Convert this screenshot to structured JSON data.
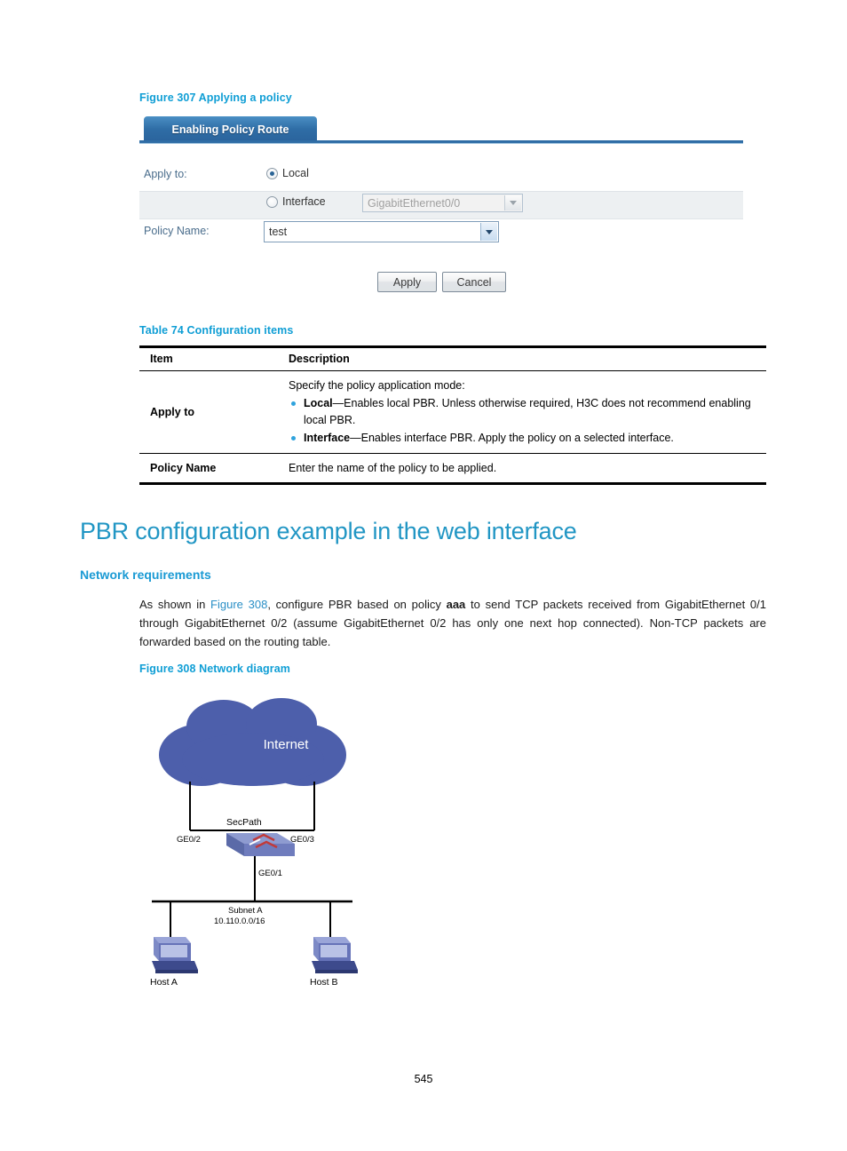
{
  "figure307": {
    "caption": "Figure 307 Applying a policy",
    "tab_label": "Enabling Policy Route",
    "apply_to_label": "Apply to:",
    "local_option": "Local",
    "interface_option": "Interface",
    "interface_select_value": "GigabitEthernet0/0",
    "policy_name_label": "Policy Name:",
    "policy_name_value": "test",
    "apply_button": "Apply",
    "cancel_button": "Cancel"
  },
  "table74": {
    "caption": "Table 74 Configuration items",
    "headers": [
      "Item",
      "Description"
    ],
    "rows": [
      {
        "item": "Apply to",
        "intro": "Specify the policy application mode:",
        "bullets": [
          {
            "term": "Local",
            "text": "—Enables local PBR. Unless otherwise required, H3C does not recommend enabling local PBR."
          },
          {
            "term": "Interface",
            "text": "—Enables interface PBR. Apply the policy on a selected interface."
          }
        ]
      },
      {
        "item": "Policy Name",
        "description": "Enter the name of the policy to be applied."
      }
    ]
  },
  "headings": {
    "h1": "PBR configuration example in the web interface",
    "h2": "Network requirements"
  },
  "body": {
    "part1": "As shown in ",
    "link": "Figure 308",
    "part2": ", configure PBR based on policy ",
    "bold1": "aaa",
    "part3": " to send TCP packets received from GigabitEthernet 0/1 through GigabitEthernet 0/2 (assume GigabitEthernet 0/2 has only one next hop connected). Non-TCP packets are forwarded based on the routing table."
  },
  "figure308": {
    "caption": "Figure 308 Network diagram",
    "cloud_label": "Internet",
    "device_label": "SecPath",
    "port_left": "GE0/2",
    "port_right": "GE0/3",
    "port_bottom": "GE0/1",
    "subnet_name": "Subnet A",
    "subnet_addr": "10.110.0.0/16",
    "host_a": "Host A",
    "host_b": "Host B"
  },
  "footer": {
    "page_number": "545"
  }
}
